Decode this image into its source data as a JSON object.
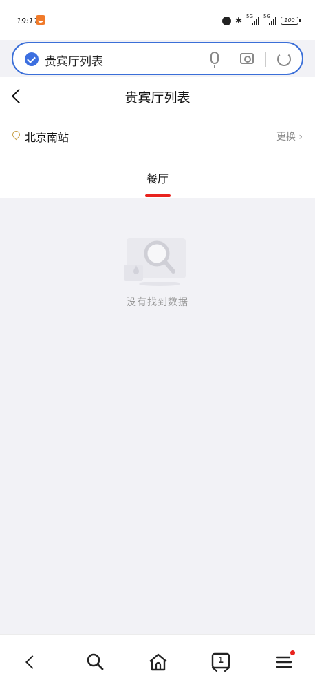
{
  "status_bar": {
    "time": "19:11",
    "signal1_label": "5G",
    "signal2_label": "5G",
    "battery": "100"
  },
  "search": {
    "query": "贵宾厅列表",
    "accent": "#3b6fd8"
  },
  "header": {
    "title": "贵宾厅列表"
  },
  "location": {
    "station": "北京南站",
    "change_label": "更换"
  },
  "tabs": [
    {
      "label": "餐厅",
      "active": true
    }
  ],
  "empty_state": {
    "message": "没有找到数据"
  },
  "bottom_nav": {
    "items": [
      "back-icon",
      "search-icon",
      "home-icon",
      "tabs-icon",
      "menu-icon"
    ],
    "tab_count": "1",
    "notification_color": "#e8231e"
  }
}
